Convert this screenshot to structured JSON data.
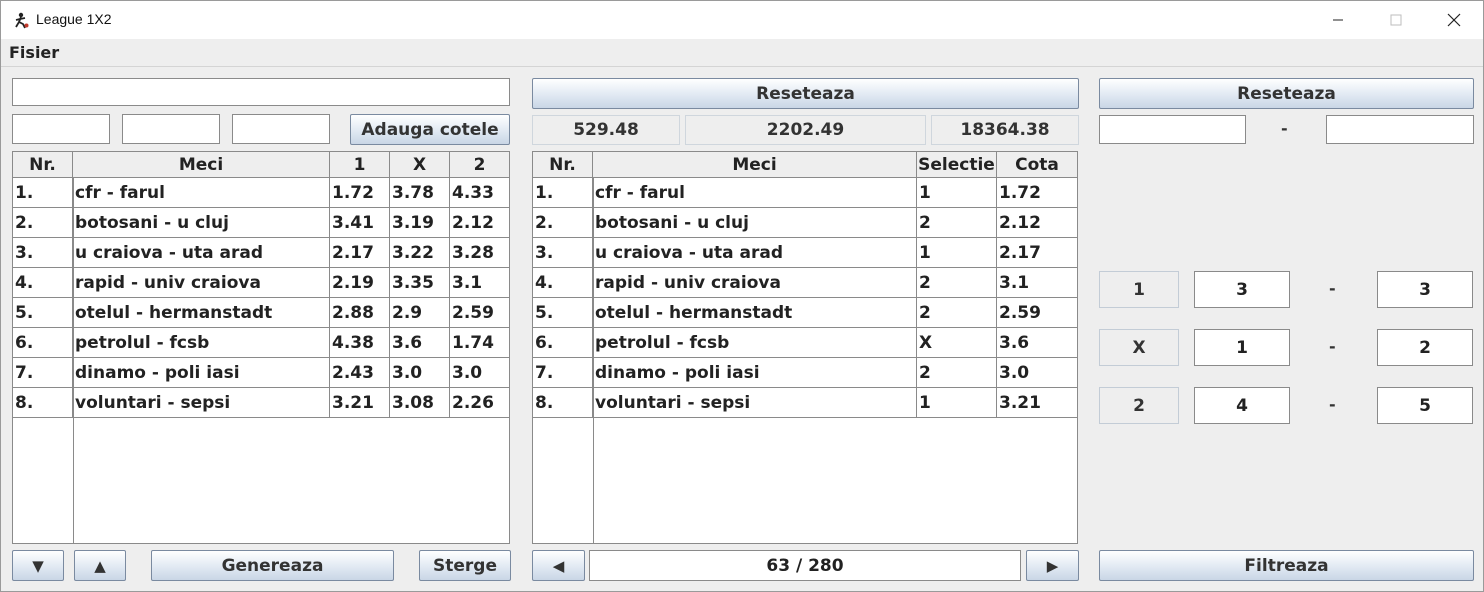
{
  "window": {
    "title": "League 1X2"
  },
  "menu": {
    "items": [
      "Fisier"
    ]
  },
  "left": {
    "team_input": "",
    "odd1_input": "",
    "oddx_input": "",
    "odd2_input": "",
    "add_button": "Adauga cotele",
    "columns": [
      "Nr.",
      "Meci",
      "1",
      "X",
      "2"
    ],
    "rows": [
      [
        "1.",
        "cfr - farul",
        "1.72",
        "3.78",
        "4.33"
      ],
      [
        "2.",
        "botosani - u cluj",
        "3.41",
        "3.19",
        "2.12"
      ],
      [
        "3.",
        "u craiova - uta arad",
        "2.17",
        "3.22",
        "3.28"
      ],
      [
        "4.",
        "rapid - univ craiova",
        "2.19",
        "3.35",
        "3.1"
      ],
      [
        "5.",
        "otelul - hermanstadt",
        "2.88",
        "2.9",
        "2.59"
      ],
      [
        "6.",
        "petrolul - fcsb",
        "4.38",
        "3.6",
        "1.74"
      ],
      [
        "7.",
        "dinamo - poli iasi",
        "2.43",
        "3.0",
        "3.0"
      ],
      [
        "8.",
        "voluntari - sepsi",
        "3.21",
        "3.08",
        "2.26"
      ]
    ],
    "down_button": "▼",
    "up_button": "▲",
    "generate_button": "Genereaza",
    "delete_button": "Sterge"
  },
  "middle": {
    "reset_button": "Reseteaza",
    "stats": [
      "529.48",
      "2202.49",
      "18364.38"
    ],
    "columns": [
      "Nr.",
      "Meci",
      "Selectie",
      "Cota"
    ],
    "rows": [
      [
        "1.",
        "cfr - farul",
        "1",
        "1.72"
      ],
      [
        "2.",
        "botosani - u cluj",
        "2",
        "2.12"
      ],
      [
        "3.",
        "u craiova - uta arad",
        "1",
        "2.17"
      ],
      [
        "4.",
        "rapid - univ craiova",
        "2",
        "3.1"
      ],
      [
        "5.",
        "otelul - hermanstadt",
        "2",
        "2.59"
      ],
      [
        "6.",
        "petrolul - fcsb",
        "X",
        "3.6"
      ],
      [
        "7.",
        "dinamo - poli iasi",
        "2",
        "3.0"
      ],
      [
        "8.",
        "voluntari - sepsi",
        "1",
        "3.21"
      ]
    ],
    "prev_button": "◀",
    "next_button": "▶",
    "page_indicator": "63 / 280"
  },
  "right": {
    "reset_button": "Reseteaza",
    "range_min": "",
    "range_dash": "-",
    "range_max": "",
    "filters": [
      {
        "label": "1",
        "min": "3",
        "dash": "-",
        "max": "3"
      },
      {
        "label": "X",
        "min": "1",
        "dash": "-",
        "max": "2"
      },
      {
        "label": "2",
        "min": "4",
        "dash": "-",
        "max": "5"
      }
    ],
    "filter_button": "Filtreaza"
  }
}
